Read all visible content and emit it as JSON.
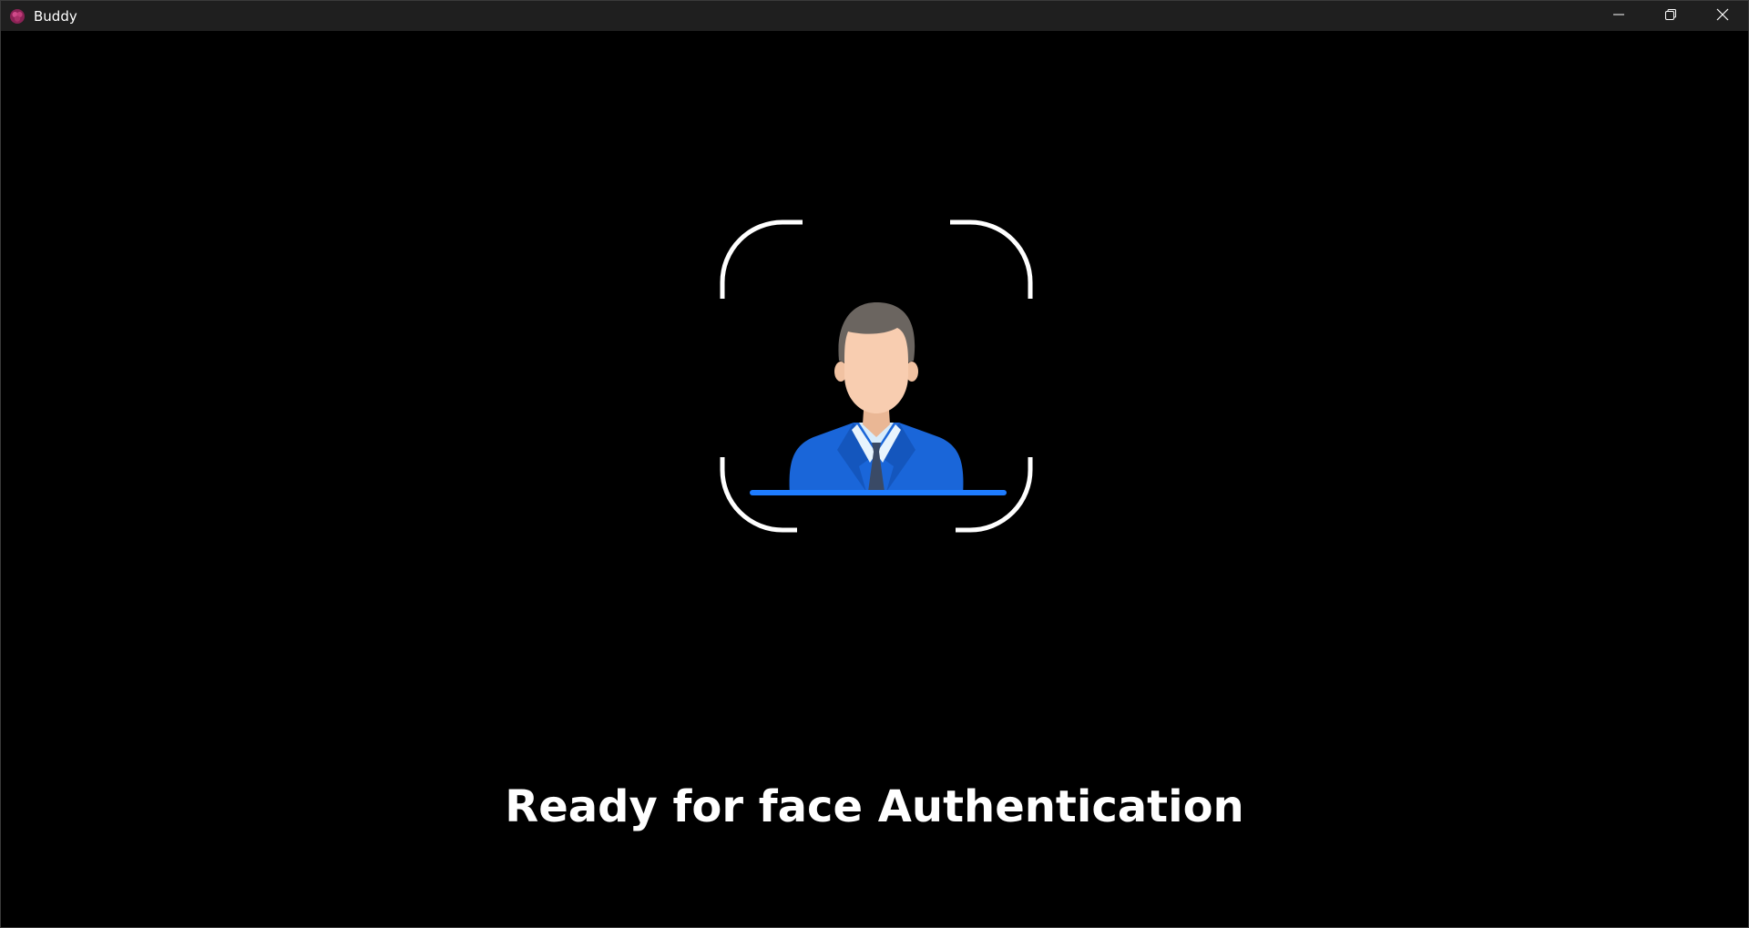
{
  "window": {
    "title": "Buddy",
    "icon": "buddy-app-icon",
    "controls": {
      "minimize_icon": "minimize-icon",
      "restore_icon": "restore-icon",
      "close_icon": "close-icon"
    }
  },
  "main": {
    "illustration": "face-scan-user-icon",
    "status_message": "Ready for face Authentication"
  },
  "colors": {
    "background": "#000000",
    "titlebar": "#1f1f1f",
    "frame": "#ffffff",
    "suit": "#1a66d9",
    "scan_line": "#1e7cff",
    "skin": "#f8cdb0",
    "hair": "#6b6560",
    "tie": "#3a4a66"
  }
}
